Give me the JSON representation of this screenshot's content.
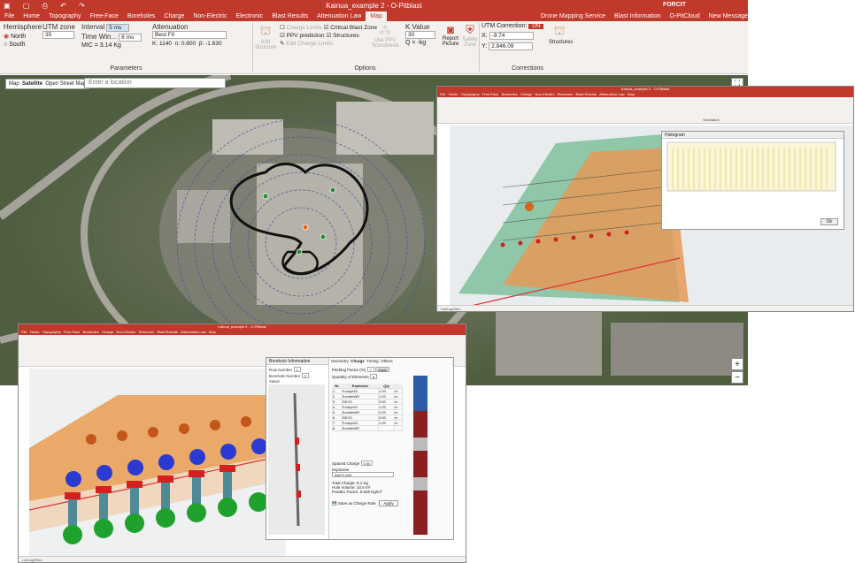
{
  "main_window": {
    "title": "Kainua_example 2 - O-Pitblast",
    "brand": "FORCIT",
    "menu": [
      "File",
      "Home",
      "Topography",
      "Free-Face",
      "Boreholes",
      "Charge",
      "Non-Electric",
      "Electronic",
      "Blast Results",
      "Attenuation Law",
      "Map"
    ],
    "active_tab": "Map",
    "menu_right": [
      "Drone Mapping Service",
      "Blast Information",
      "O-PitCloud",
      "New Message"
    ],
    "params": {
      "hemisphere_label": "Hemisphere",
      "north": "North",
      "south": "South",
      "utm_zone_label": "UTM zone",
      "utm_zone_value": "35",
      "interval_label": "Interval",
      "interval_value": "5 ms",
      "time_window_label": "Time Win...",
      "time_window_value": "8 ms",
      "mic": "MIC = 3.14 Kg",
      "attenuation_label": "Attenuation",
      "attenuation_value": "Best Fit",
      "k_label": "K:",
      "k_value": "1140",
      "n_label": "n:",
      "n_value": "0.800",
      "beta_label": "β:",
      "beta_value": "-1.630",
      "kvalue_label": "K Value",
      "kvalue_value": "30",
      "q_label": "Q = -kg",
      "group_label": "Parameters"
    },
    "options": {
      "add_structure": "Add Structure",
      "charge_limits": "Charge Limits",
      "critical_blast_zone": "Critical Blast Zone",
      "ppv_prediction": "PPV prediction",
      "structures": "Structures",
      "edit_charge_limits": "Edit Charge Limits",
      "use_ppv": "Use PPV Scondneria",
      "report_picture": "Report Picture",
      "safety_zone": "Safety Zone",
      "group_label": "Options"
    },
    "corrections": {
      "utm_label": "UTM Correction:",
      "utm_state": "ON",
      "x_label": "X:",
      "x_value": "-9.74",
      "y_label": "Y:",
      "y_value": "2.846.09",
      "structures": "Structures",
      "group_label": "Corrections"
    },
    "map": {
      "tools": [
        "Map",
        "Satellite",
        "Open Street Map"
      ],
      "search_placeholder": "Enter a location",
      "zoom_in": "+",
      "zoom_out": "−",
      "fullscreen": "⛶"
    }
  },
  "window2": {
    "title": "Kainua_example 2 - O-Pitblast",
    "dialog_title": "Histogram",
    "group_label": "Simulation",
    "status": "Lat/Lng/Elev",
    "close": "Ok"
  },
  "window3": {
    "title": "Kainua_example 2 - O-Pitblast",
    "borehole_dialog_title": "Borehole Information",
    "row_number_label": "Row Number",
    "row_number_value": "1",
    "borehole_number_label": "Borehole Number",
    "borehole_number_value": "3",
    "view_label": "Views",
    "tabs": [
      "Geometry",
      "Charge",
      "Timing",
      "Others"
    ],
    "packing_factor_label": "Packing Factor (%)",
    "packing_factor_value": "7",
    "apply": "Apply",
    "quantity_label": "Quantity of Elements",
    "quantity_value": "8",
    "table_headers": [
      "Nr.",
      "Explosive",
      "Qty",
      ""
    ],
    "table_rows": [
      [
        "1",
        "Fordyn63",
        "1.00",
        "m"
      ],
      [
        "2",
        "KemiteWR",
        "1.00",
        "m"
      ],
      [
        "3",
        "DECK",
        "0.50",
        "m"
      ],
      [
        "4",
        "Fordyn63",
        "1.00",
        "m"
      ],
      [
        "5",
        "KemiteWR",
        "2.00",
        "m"
      ],
      [
        "6",
        "DECK",
        "0.50",
        "m"
      ],
      [
        "7",
        "Fordyn63",
        "1.00",
        "m"
      ],
      [
        "8",
        "KemiteWR",
        "",
        ""
      ]
    ],
    "spaced_charge_label": "Spaced Charge",
    "spaced_charge_value": "0.00",
    "explosive_label": "Explosive",
    "explosive_value": "ANFO-MIX",
    "total_charge": "Total Charge: 5.1 Kg",
    "hole_volume": "Hole Volume: 10.6 m³",
    "powder_factor": "Powder Factor: 0.526 Kg/m³",
    "save_label": "Save as Charge Rule",
    "apply_button": "Apply",
    "status": "Lat/Lng/Elev"
  }
}
